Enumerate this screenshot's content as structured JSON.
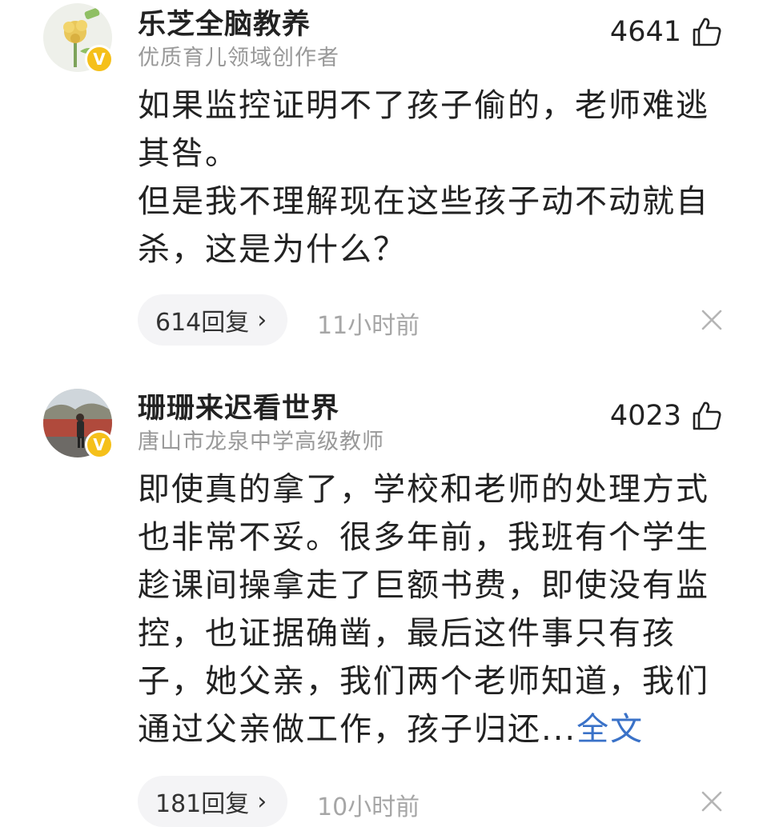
{
  "comments": [
    {
      "username": "乐芝全脑教养",
      "user_title": "优质育儿领域创作者",
      "verified_badge": "V",
      "likes": "4641",
      "paragraphs": [
        "如果监控证明不了孩子偷的，老师难逃其咎。",
        "但是我不理解现在这些孩子动不动就自杀，这是为什么？"
      ],
      "reply_label": "614回复",
      "reply_chevron": "›",
      "time": "11小时前"
    },
    {
      "username": "珊珊来迟看世界",
      "user_title": "唐山市龙泉中学高级教师",
      "verified_badge": "V",
      "likes": "4023",
      "paragraphs": [
        "即使真的拿了，学校和老师的处理方式也非常不妥。很多年前，我班有个学生趁课间操拿走了巨额书费，即使没有监控，也证据确凿，最后这件事只有孩子，她父亲，我们两个老师知道，我们通过父亲做工作，孩子归还..."
      ],
      "full_text_link": "全文",
      "reply_label": "181回复",
      "reply_chevron": "›",
      "time": "10小时前"
    }
  ],
  "icons": {
    "like": "thumbs-up-icon",
    "close": "close-icon",
    "verified": "verified-badge-icon"
  },
  "colors": {
    "link": "#3a72c8",
    "badge": "#f5c01a",
    "muted": "#999999"
  }
}
